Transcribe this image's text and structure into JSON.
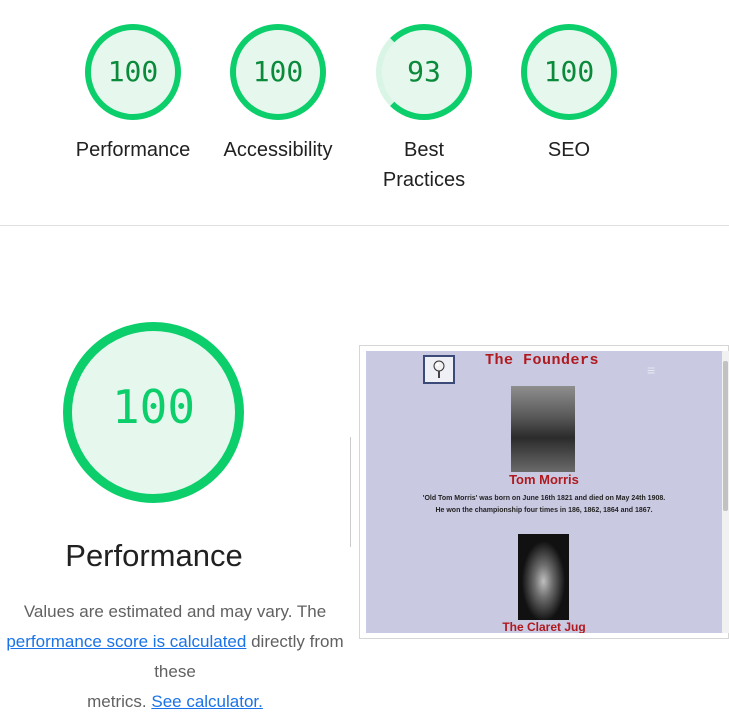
{
  "gauges": [
    {
      "score": "100",
      "label": "Performance"
    },
    {
      "score": "100",
      "label": "Accessibility"
    },
    {
      "score": "93",
      "label_line1": "Best",
      "label_line2": "Practices"
    },
    {
      "score": "100",
      "label": "SEO"
    }
  ],
  "performance": {
    "score": "100",
    "title": "Performance",
    "desc_line1": "Values are estimated and may vary. The",
    "desc_link1": "performance score is calculated",
    "desc_line2_rest": " directly from these",
    "desc_line3": "metrics. ",
    "desc_link2": "See calculator."
  },
  "screenshot": {
    "title": "The Founders",
    "person": "Tom Morris",
    "bio_line1": "'Old Tom Morris' was born on June 16th 1821 and died on May 24th 1908.",
    "bio_line2": "He won the championship four times in 186, 1862, 1864 and 1867.",
    "item2": "The Claret Jug"
  },
  "colors": {
    "pass": "#0cce6b",
    "pass_bg": "#e6f8ee",
    "link": "#1a73e8",
    "heading_red": "#b0191e"
  }
}
